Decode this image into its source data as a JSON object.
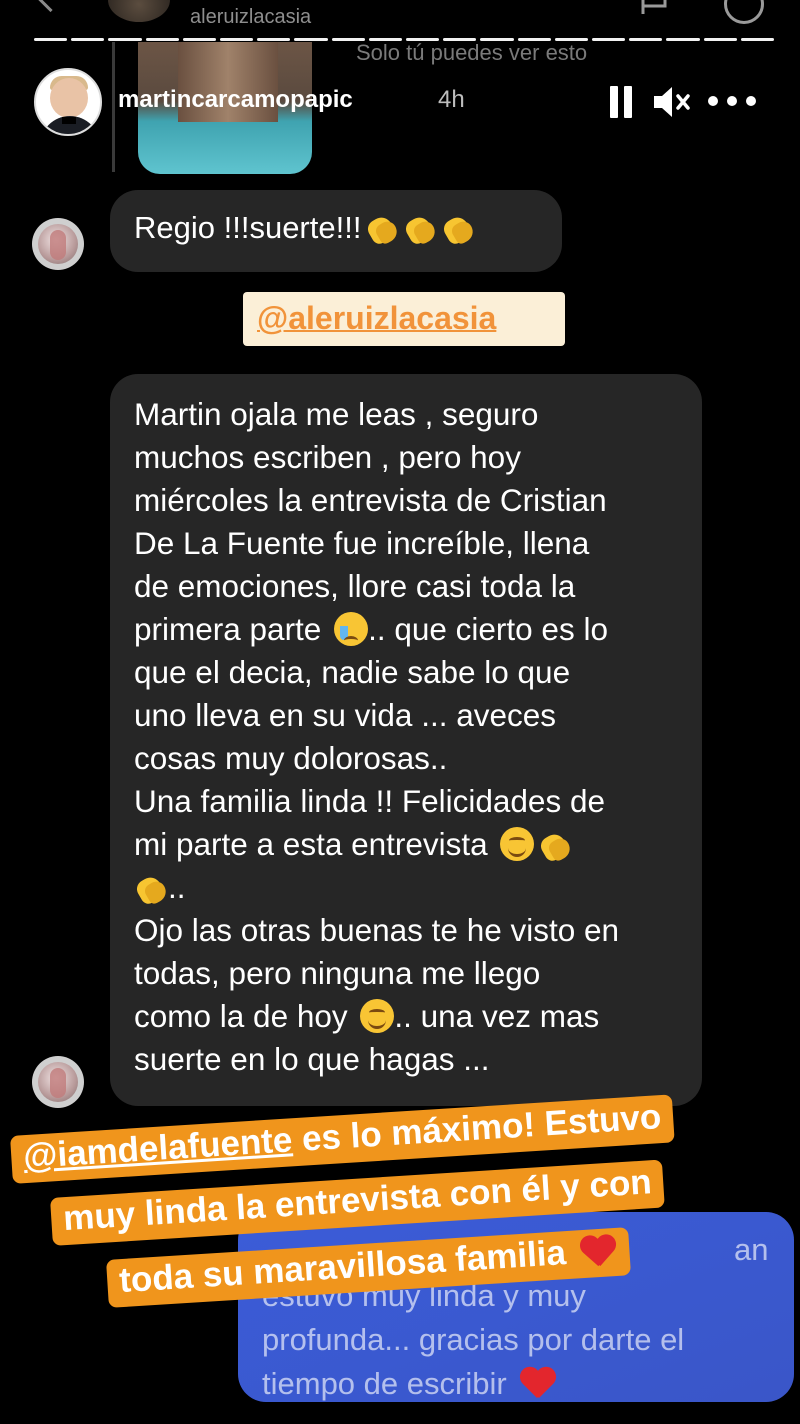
{
  "dm_header": {
    "username": "aleruizlacasia"
  },
  "story": {
    "username": "martincarcamopapic",
    "time": "4h",
    "progress_segments": 20,
    "only_you_note": "Solo tú puedes ver esto"
  },
  "messages": {
    "first": "Regio !!!suerte!!!",
    "mention_sticker": "@aleruizlacasia",
    "long_lines": [
      "Martin ojala me leas , seguro",
      "muchos escriben , pero hoy",
      "miércoles la entrevista de Cristian",
      "De La Fuente fue increíble, llena",
      "de emociones, llore casi toda la",
      "primera parte",
      ".. que cierto es lo",
      "que el decia, nadie sabe lo que",
      "uno lleva en su vida ... aveces",
      "cosas muy dolorosas..",
      "Una familia linda !! Felicidades de",
      "mi parte a esta entrevista",
      "..",
      "Ojo las otras buenas te he visto en",
      "todas, pero ninguna me llego",
      "como la de hoy",
      ".. una vez mas",
      "suerte en lo que hagas ..."
    ],
    "reply_lines": [
      "an",
      "estuvo muy linda y muy",
      "profunda... gracias por darte el",
      "tiempo de escribir"
    ]
  },
  "caption": {
    "mention": "@iamdelafuente",
    "line1_rest": " es lo máximo! Estuvo",
    "line2": "muy linda la entrevista con él y con",
    "line3": "toda su maravillosa familia"
  },
  "colors": {
    "bubble": "#262626",
    "reply_bubble": "#3b5cd8",
    "caption_bg": "#f0951c",
    "mention_text": "#f1933a",
    "heart": "#e3262d"
  }
}
